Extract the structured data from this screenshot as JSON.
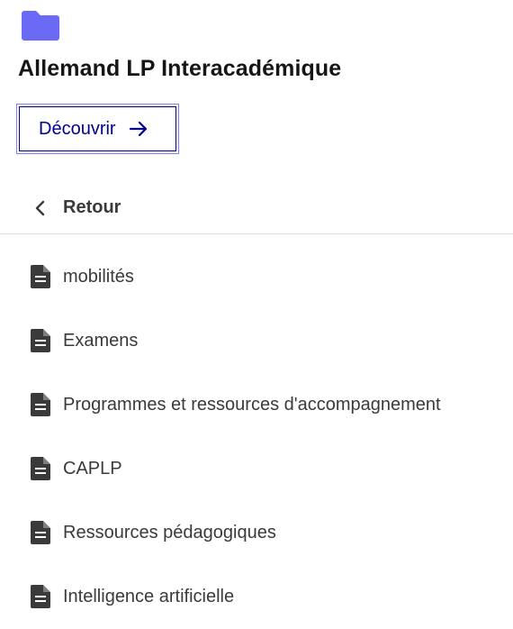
{
  "page": {
    "title": "Allemand LP Interacadémique",
    "folder_icon": "folder-icon",
    "accent_color": "#6a6af4"
  },
  "discover_button": {
    "label": "Découvrir",
    "icon": "arrow-right-icon",
    "color": "#000091"
  },
  "back": {
    "label": "Retour",
    "icon": "chevron-left-icon"
  },
  "menu": {
    "items": [
      {
        "label": "mobilités",
        "icon": "file-icon"
      },
      {
        "label": "Examens",
        "icon": "file-icon"
      },
      {
        "label": "Programmes et ressources d'accompagnement",
        "icon": "file-icon"
      },
      {
        "label": "CAPLP",
        "icon": "file-icon"
      },
      {
        "label": "Ressources pédagogiques",
        "icon": "file-icon"
      },
      {
        "label": "Intelligence artificielle",
        "icon": "file-icon"
      }
    ]
  }
}
